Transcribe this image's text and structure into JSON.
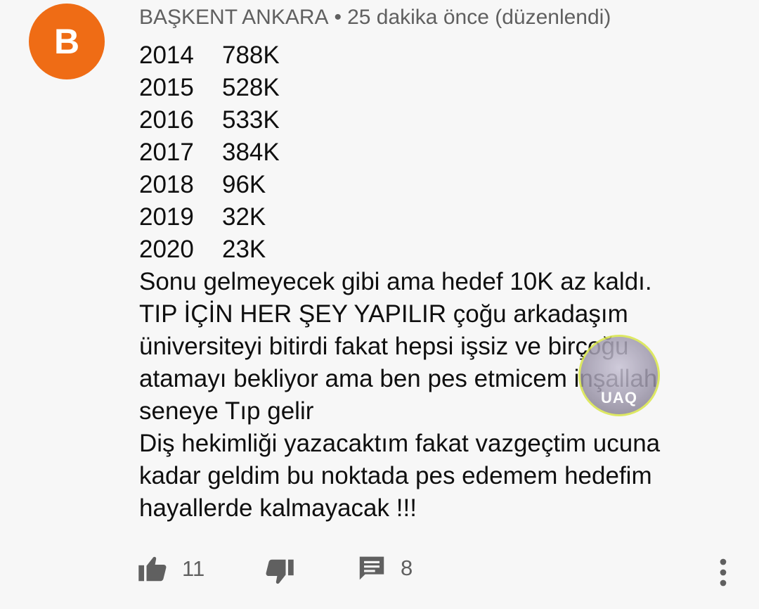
{
  "comment": {
    "avatar_letter": "B",
    "avatar_color": "#ef6c15",
    "author": "BAŞKENT ANKARA",
    "separator": "•",
    "time": "25 dakika önce (düzenlendi)",
    "stats": [
      {
        "year": "2014",
        "value": "788K"
      },
      {
        "year": "2015",
        "value": "528K"
      },
      {
        "year": "2016",
        "value": "533K"
      },
      {
        "year": "2017",
        "value": "384K"
      },
      {
        "year": "2018",
        "value": "96K"
      },
      {
        "year": "2019",
        "value": "32K"
      },
      {
        "year": "2020",
        "value": "23K"
      }
    ],
    "lines": [
      "Sonu gelmeyecek gibi ama hedef 10K az kaldı.",
      "TIP İÇİN HER ŞEY YAPILIR çoğu arkadaşım",
      "üniversiteyi bitirdi fakat hepsi işsiz ve birçoğu",
      "atamayı bekliyor ama ben pes etmicem inşallah",
      "seneye Tıp gelir",
      "Diş hekimliği yazacaktım fakat vazgeçtim ucuna",
      "kadar geldim bu noktada pes edemem hedefim",
      "hayallerde kalmayacak !!!"
    ]
  },
  "watermark": {
    "text": "UAQ"
  },
  "toolbar": {
    "like_icon": "thumbs-up-icon",
    "like_count": "11",
    "dislike_icon": "thumbs-down-icon",
    "reply_icon": "comment-icon",
    "reply_count": "8",
    "more_icon": "more-vertical-icon"
  }
}
